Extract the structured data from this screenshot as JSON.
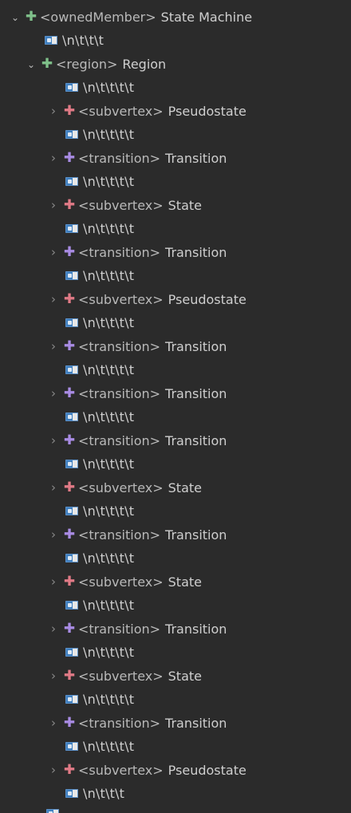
{
  "colors": {
    "background": "#2b2b2b",
    "green_plus": "#7fc08a",
    "red_plus": "#e07a86",
    "purple_plus": "#a88be3"
  },
  "root": {
    "tag": "<ownedMember>",
    "name": "State Machine",
    "text_node": "\\n\\t\\t\\t"
  },
  "region": {
    "tag": "<region>",
    "name": "Region",
    "text_node": "\\n\\t\\t\\t\\t"
  },
  "children": [
    {
      "tag": "<subvertex>",
      "name": "Pseudostate",
      "kind": "subvertex",
      "text": "\\n\\t\\t\\t\\t"
    },
    {
      "tag": "<transition>",
      "name": "Transition",
      "kind": "transition",
      "text": "\\n\\t\\t\\t\\t"
    },
    {
      "tag": "<subvertex>",
      "name": "State",
      "kind": "subvertex",
      "text": "\\n\\t\\t\\t\\t"
    },
    {
      "tag": "<transition>",
      "name": "Transition",
      "kind": "transition",
      "text": "\\n\\t\\t\\t\\t"
    },
    {
      "tag": "<subvertex>",
      "name": "Pseudostate",
      "kind": "subvertex",
      "text": "\\n\\t\\t\\t\\t"
    },
    {
      "tag": "<transition>",
      "name": "Transition",
      "kind": "transition",
      "text": "\\n\\t\\t\\t\\t"
    },
    {
      "tag": "<transition>",
      "name": "Transition",
      "kind": "transition",
      "text": "\\n\\t\\t\\t\\t"
    },
    {
      "tag": "<transition>",
      "name": "Transition",
      "kind": "transition",
      "text": "\\n\\t\\t\\t\\t"
    },
    {
      "tag": "<subvertex>",
      "name": "State",
      "kind": "subvertex",
      "text": "\\n\\t\\t\\t\\t"
    },
    {
      "tag": "<transition>",
      "name": "Transition",
      "kind": "transition",
      "text": "\\n\\t\\t\\t\\t"
    },
    {
      "tag": "<subvertex>",
      "name": "State",
      "kind": "subvertex",
      "text": "\\n\\t\\t\\t\\t"
    },
    {
      "tag": "<transition>",
      "name": "Transition",
      "kind": "transition",
      "text": "\\n\\t\\t\\t\\t"
    },
    {
      "tag": "<subvertex>",
      "name": "State",
      "kind": "subvertex",
      "text": "\\n\\t\\t\\t\\t"
    },
    {
      "tag": "<transition>",
      "name": "Transition",
      "kind": "transition",
      "text": "\\n\\t\\t\\t\\t"
    },
    {
      "tag": "<subvertex>",
      "name": "Pseudostate",
      "kind": "subvertex",
      "text": "\\n\\t\\t\\t"
    }
  ]
}
